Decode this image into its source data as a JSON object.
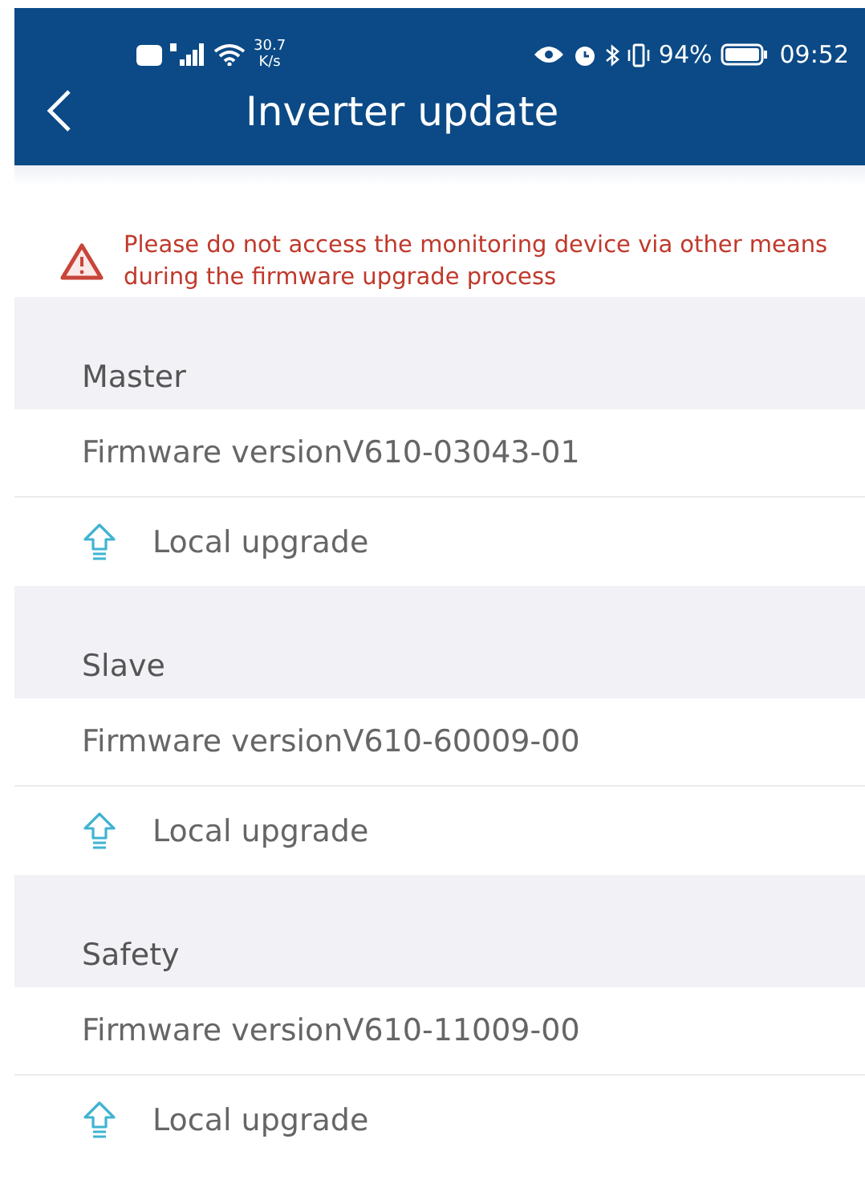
{
  "status_bar": {
    "network_speed": "30.7",
    "speed_unit": "K/s",
    "battery": "94%",
    "time": "09:52"
  },
  "header": {
    "title": "Inverter update"
  },
  "warning": "Please do not access the monitoring device via other means during the firmware upgrade process",
  "sections": [
    {
      "title": "Master",
      "firmware": "Firmware versionV610-03043-01",
      "action": "Local upgrade"
    },
    {
      "title": "Slave",
      "firmware": "Firmware versionV610-60009-00",
      "action": "Local upgrade"
    },
    {
      "title": "Safety",
      "firmware": "Firmware versionV610-11009-00",
      "action": "Local upgrade"
    }
  ]
}
